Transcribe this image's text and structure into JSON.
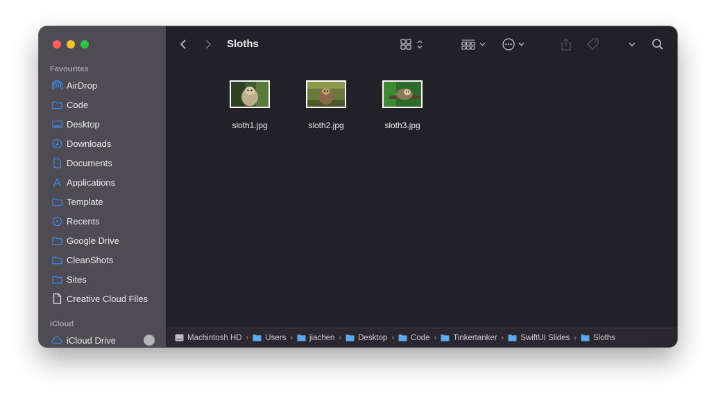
{
  "window": {
    "title": "Sloths"
  },
  "sidebar": {
    "favourites_label": "Favourites",
    "items": [
      {
        "label": "AirDrop",
        "icon": "airdrop-icon"
      },
      {
        "label": "Code",
        "icon": "folder-icon"
      },
      {
        "label": "Desktop",
        "icon": "desktop-icon"
      },
      {
        "label": "Downloads",
        "icon": "download-icon"
      },
      {
        "label": "Documents",
        "icon": "document-icon"
      },
      {
        "label": "Applications",
        "icon": "applications-icon"
      },
      {
        "label": "Template",
        "icon": "folder-icon"
      },
      {
        "label": "Recents",
        "icon": "clock-icon"
      },
      {
        "label": "Google Drive",
        "icon": "folder-icon"
      },
      {
        "label": "CleanShots",
        "icon": "folder-icon"
      },
      {
        "label": "Sites",
        "icon": "folder-icon"
      },
      {
        "label": "Creative Cloud Files",
        "icon": "file-icon"
      }
    ],
    "icloud_label": "iCloud",
    "icloud_drive": "iCloud Drive"
  },
  "files": [
    {
      "name": "sloth1.jpg"
    },
    {
      "name": "sloth2.jpg"
    },
    {
      "name": "sloth3.jpg"
    }
  ],
  "pathbar": [
    "Machintosh HD",
    "Users",
    "jiachen",
    "Desktop",
    "Code",
    "Tinkertanker",
    "SwiftUI Slides",
    "Sloths"
  ],
  "colors": {
    "accent": "#3b8ef5",
    "sidebar": "#4e4c52",
    "content": "#232128"
  }
}
